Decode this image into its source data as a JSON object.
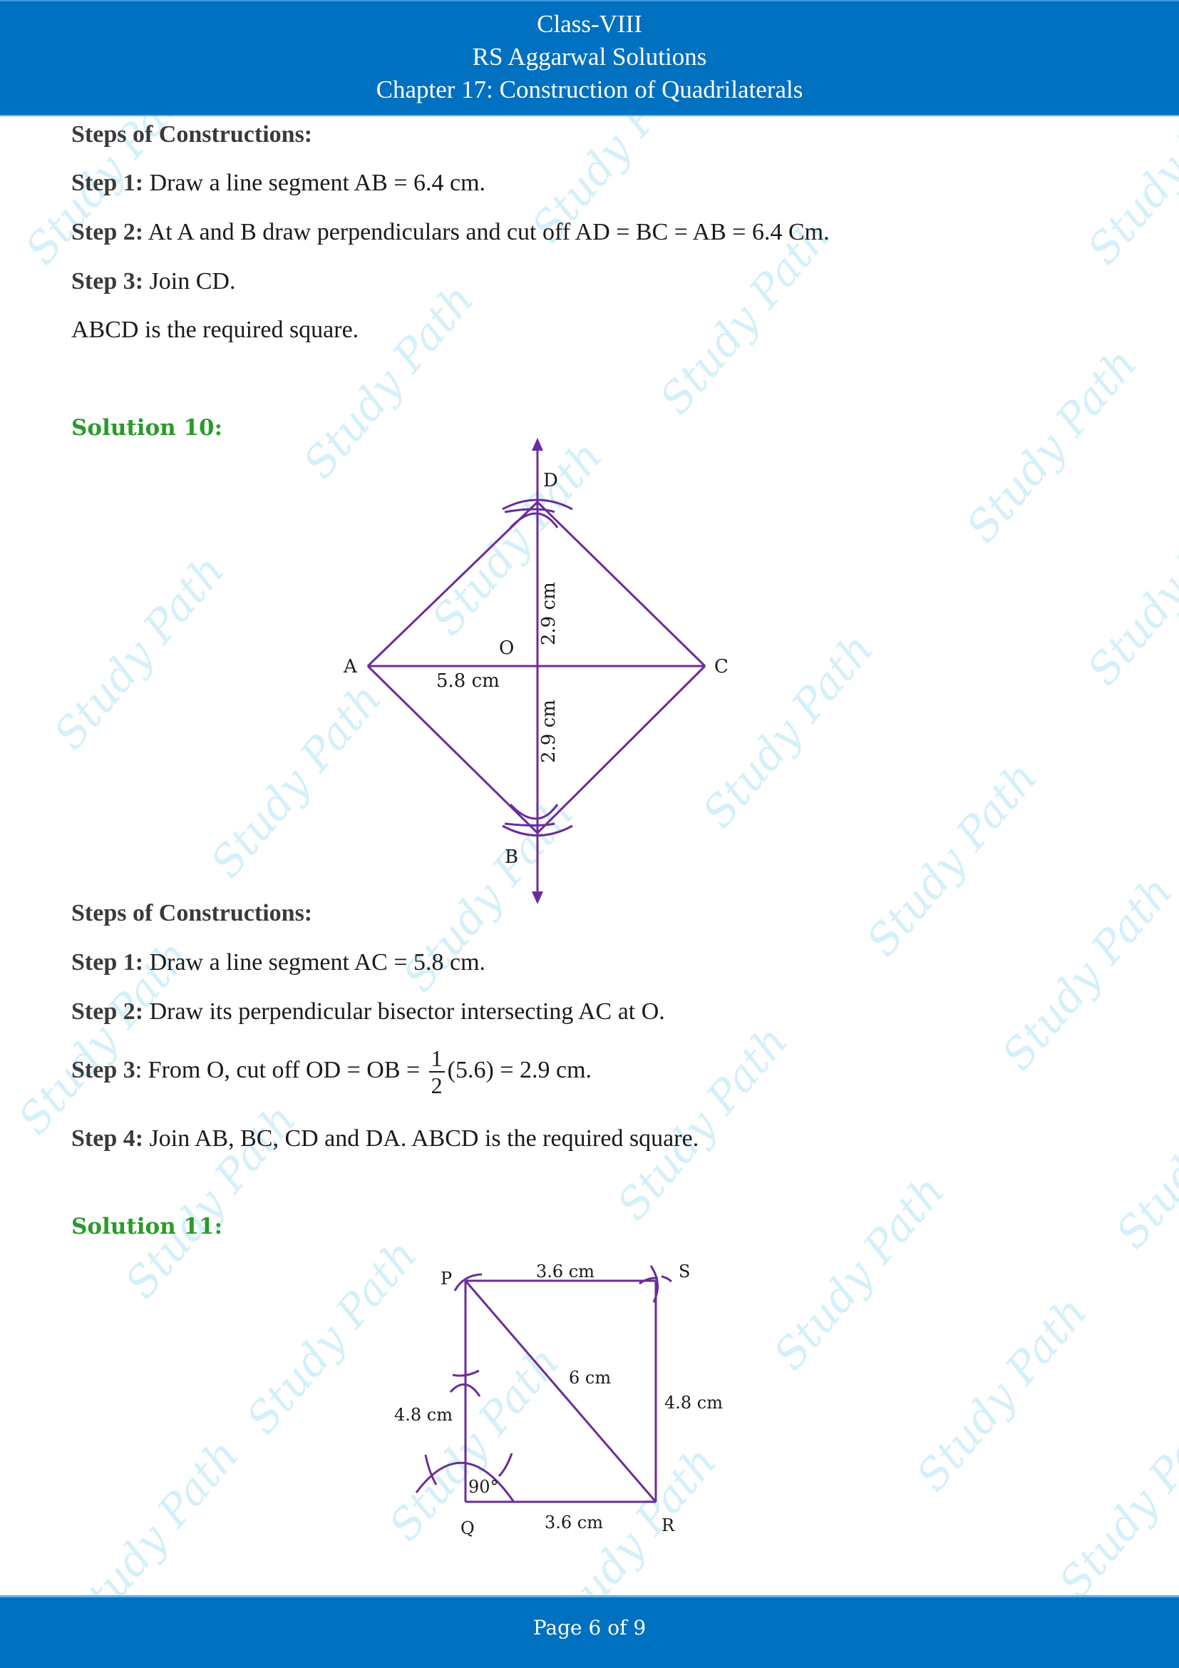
{
  "header": {
    "line1": "Class-VIII",
    "line2": "RS Aggarwal Solutions",
    "line3": "Chapter 17: Construction of Quadrilaterals"
  },
  "watermark_text": "Study Path",
  "section1": {
    "heading": "Steps of Constructions:",
    "steps": [
      {
        "label": "Step 1:",
        "text": " Draw a line segment AB = 6.4 cm."
      },
      {
        "label": "Step 2:",
        "text": " At A and B draw perpendiculars and cut off AD = BC = AB = 6.4 Cm."
      },
      {
        "label": "Step 3:",
        "text": " Join CD."
      }
    ],
    "conclusion": "ABCD is the required square."
  },
  "solution10": {
    "title": "Solution 10:",
    "diagram": {
      "points": {
        "A": "A",
        "B": "B",
        "C": "C",
        "D": "D",
        "O": "O"
      },
      "labels": {
        "AC": "5.8 cm",
        "OD": "2.9 cm",
        "OB": "2.9 cm"
      }
    },
    "heading": "Steps of Constructions:",
    "steps": [
      {
        "label": "Step 1:",
        "text": " Draw a line segment AC = 5.8 cm."
      },
      {
        "label": "Step 2:",
        "text": " Draw its perpendicular bisector intersecting AC at O."
      },
      {
        "label": "Step 3",
        "text_before": ": From O, cut off OD = OB = ",
        "frac_num": "1",
        "frac_den": "2",
        "text_after": "(5.6) = 2.9 cm."
      },
      {
        "label": "Step 4:",
        "text": " Join AB, BC, CD and DA. ABCD is the required square."
      }
    ]
  },
  "solution11": {
    "title": "Solution 11:",
    "diagram": {
      "points": {
        "P": "P",
        "Q": "Q",
        "R": "R",
        "S": "S"
      },
      "labels": {
        "PS": "3.6 cm",
        "QR": "3.6 cm",
        "PQ": "4.8 cm",
        "SR": "4.8 cm",
        "PR": "6 cm",
        "angleQ": "90°"
      }
    }
  },
  "footer": {
    "page_label": "Page 6 of 9"
  },
  "colors": {
    "header_bg": "#0070c0",
    "solution_green": "#2a9a2a",
    "diagram_purple": "#6a2c9a",
    "watermark": "#cdeef8"
  }
}
